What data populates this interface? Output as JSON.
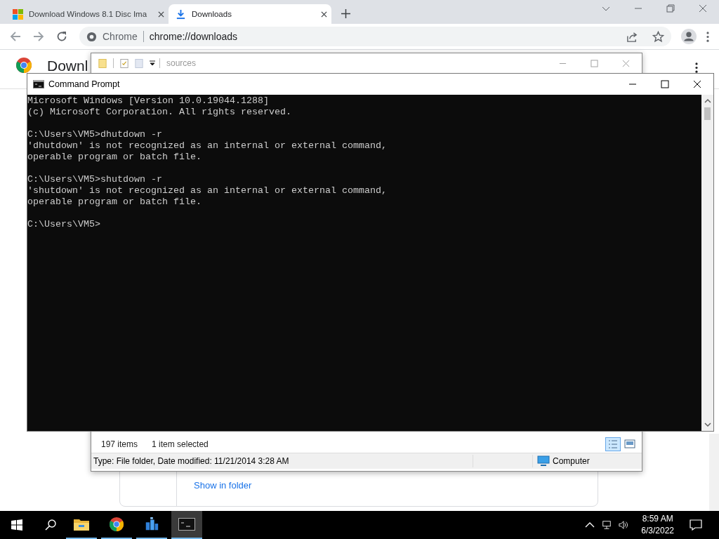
{
  "browser": {
    "tabs": [
      {
        "title": "Download Windows 8.1 Disc Ima",
        "kind": "windows",
        "selected": false
      },
      {
        "title": "Downloads",
        "kind": "download",
        "selected": true
      }
    ],
    "address": {
      "site": "Chrome",
      "url": "chrome://downloads"
    },
    "page": {
      "heading": "Downl",
      "link": "Show in folder"
    }
  },
  "explorer": {
    "title": "sources",
    "item_count": "197 items",
    "selection": "1 item selected",
    "details": "Type: File folder, Date modified: 11/21/2014 3:28 AM",
    "location": "Computer"
  },
  "console": {
    "title": "Command Prompt",
    "blocks": [
      [
        "Microsoft Windows [Version 10.0.19044.1288]",
        "(c) Microsoft Corporation. All rights reserved."
      ],
      [
        "C:\\Users\\VM5>dhutdown -r",
        "'dhutdown' is not recognized as an internal or external command,",
        "operable program or batch file."
      ],
      [
        "C:\\Users\\VM5>shutdown -r",
        "'shutdown' is not recognized as an internal or external command,",
        "operable program or batch file."
      ],
      [
        "C:\\Users\\VM5>"
      ]
    ]
  },
  "taskbar": {
    "apps": [
      {
        "kind": "folder",
        "running": true,
        "selected": false
      },
      {
        "kind": "chrome",
        "running": true,
        "selected": false
      },
      {
        "kind": "blocks",
        "running": true,
        "selected": false
      },
      {
        "kind": "console",
        "running": true,
        "selected": true
      }
    ],
    "time": "8:59 AM",
    "date": "6/3/2022"
  }
}
